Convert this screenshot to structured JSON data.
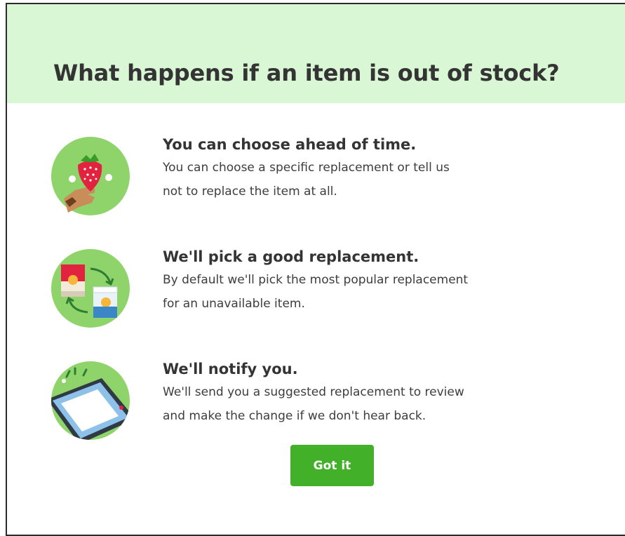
{
  "dialog": {
    "title": "What happens if an item is out of stock?",
    "accent_color": "#43b02a",
    "header_color": "#d9f7d4"
  },
  "features": [
    {
      "icon": "hand-holding-strawberry-icon",
      "heading": "You can choose ahead of time.",
      "description_lines": [
        "You can choose a specific replacement or tell us",
        "not to replace the item at all."
      ]
    },
    {
      "icon": "product-swap-icon",
      "heading": "We'll pick a good replacement.",
      "description_lines": [
        "By default we'll pick the most popular replacement",
        "for an unavailable item."
      ]
    },
    {
      "icon": "phone-notification-icon",
      "heading": "We'll notify you.",
      "description_lines": [
        "We'll send you a suggested replacement to review",
        "and make the change if we don't hear back."
      ]
    }
  ],
  "actions": {
    "got_it_label": "Got it"
  }
}
